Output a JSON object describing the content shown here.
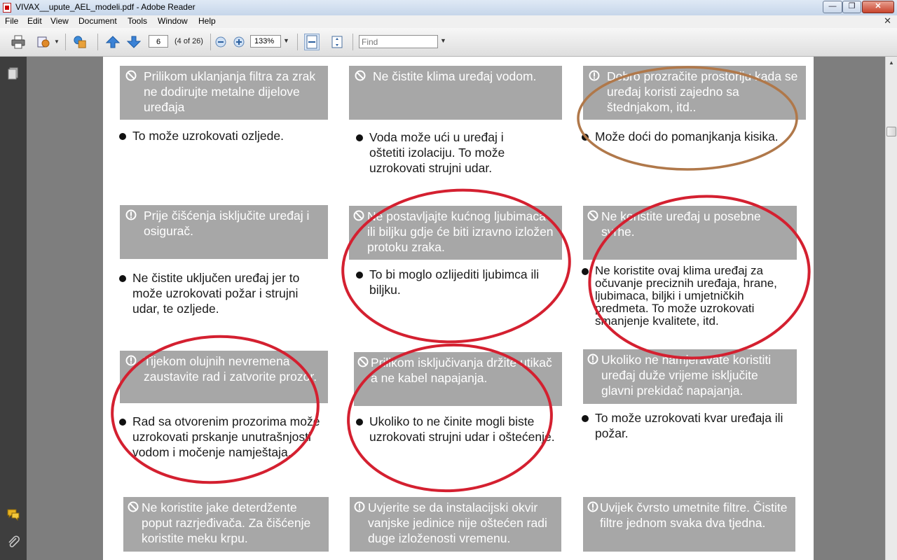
{
  "window": {
    "title": "VIVAX__upute_AEL_modeli.pdf - Adobe Reader",
    "minimize": "—",
    "maximize": "❐",
    "close": "✕"
  },
  "menu": [
    "File",
    "Edit",
    "View",
    "Document",
    "Tools",
    "Window",
    "Help"
  ],
  "menu_close": "✕",
  "toolbar": {
    "page_number": "6",
    "page_count": "(4 of 26)",
    "zoom": "133%",
    "find_placeholder": "Find"
  },
  "scroll_up": "▲",
  "sections": [
    {
      "type": "prohibit",
      "heading": "Prilikom uklanjanja filtra za zrak ne dodirujte metalne dijelove uređaja",
      "note": "To može uzrokovati ozljede."
    },
    {
      "type": "prohibit",
      "heading": "Ne čistite klima uređaj vodom.",
      "note": "Voda može ući u uređaj i oštetiti izolaciju. To može uzrokovati strujni udar."
    },
    {
      "type": "caution",
      "heading": "Dobro prozračite prostoriju kada se uređaj koristi zajedno sa štednjakom, itd..",
      "note": "Može doći do pomanjkanja kisika."
    },
    {
      "type": "caution",
      "heading": "Prije čišćenja isključite uređaj i osigurač.",
      "note": "Ne čistite uključen uređaj jer to može uzrokovati požar i strujni udar, te ozljede."
    },
    {
      "type": "prohibit",
      "heading": "Ne postavljajte kućnog ljubimaca ili biljku gdje će biti izravno izložen protoku zraka.",
      "note": "To bi moglo ozlijediti ljubimca ili biljku."
    },
    {
      "type": "prohibit",
      "heading": "Ne koristite uređaj u posebne svrhe.",
      "note": "Ne koristite ovaj klima uređaj za očuvanje preciznih uređaja, hrane, ljubimaca, biljki i umjetničkih predmeta. To može uzrokovati smanjenje kvalitete, itd."
    },
    {
      "type": "caution",
      "heading": "Tijekom olujnih nevremena zaustavite rad i zatvorite prozor.",
      "note": "Rad sa otvorenim prozorima može uzrokovati prskanje unutrašnjosti vodom i močenje namještaja."
    },
    {
      "type": "prohibit",
      "heading": "Prilikom isključivanja držite utikač a ne kabel napajanja.",
      "note": "Ukoliko to ne činite mogli biste uzrokovati strujni udar i oštećenje."
    },
    {
      "type": "caution",
      "heading": "Ukoliko ne namjeravate koristiti uređaj duže vrijeme isključite glavni prekidač napajanja.",
      "note": "To može uzrokovati kvar uređaja ili požar."
    },
    {
      "type": "prohibit",
      "heading": "Ne koristite jake deterdžente poput razrjeđivača. Za čišćenje koristite meku krpu.",
      "note": ""
    },
    {
      "type": "caution",
      "heading": "Uvjerite se da instalacijski okvir vanjske jedinice nije oštećen radi duge izloženosti vremenu.",
      "note": ""
    },
    {
      "type": "caution",
      "heading": "Uvijek čvrsto umetnite filtre. Čistite filtre jednom svaka dva tjedna.",
      "note": ""
    }
  ],
  "colors": {
    "card": "#a7a7a7",
    "annotation_red": "#d42030",
    "annotation_brown": "#b0784a",
    "nav": "#3e3e3e",
    "doc_bg": "#7e7e7e"
  }
}
